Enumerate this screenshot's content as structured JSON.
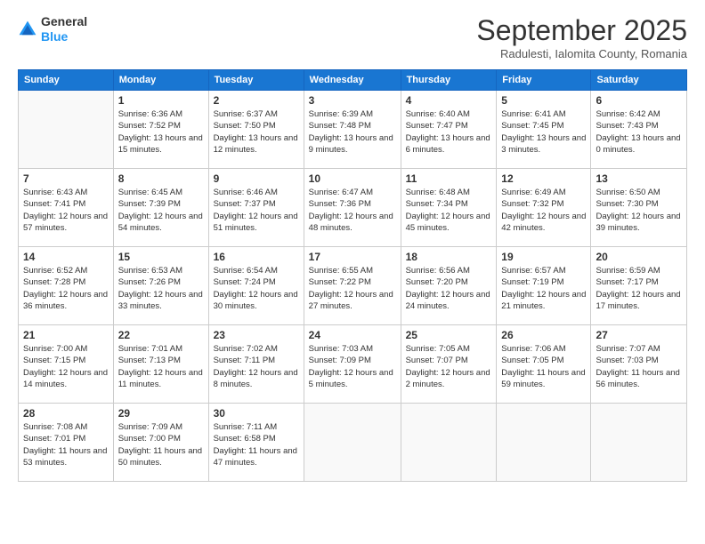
{
  "header": {
    "logo_general": "General",
    "logo_blue": "Blue",
    "month_title": "September 2025",
    "subtitle": "Radulesti, Ialomita County, Romania"
  },
  "days_of_week": [
    "Sunday",
    "Monday",
    "Tuesday",
    "Wednesday",
    "Thursday",
    "Friday",
    "Saturday"
  ],
  "weeks": [
    [
      {
        "day": "",
        "empty": true
      },
      {
        "day": "1",
        "sunrise": "Sunrise: 6:36 AM",
        "sunset": "Sunset: 7:52 PM",
        "daylight": "Daylight: 13 hours and 15 minutes."
      },
      {
        "day": "2",
        "sunrise": "Sunrise: 6:37 AM",
        "sunset": "Sunset: 7:50 PM",
        "daylight": "Daylight: 13 hours and 12 minutes."
      },
      {
        "day": "3",
        "sunrise": "Sunrise: 6:39 AM",
        "sunset": "Sunset: 7:48 PM",
        "daylight": "Daylight: 13 hours and 9 minutes."
      },
      {
        "day": "4",
        "sunrise": "Sunrise: 6:40 AM",
        "sunset": "Sunset: 7:47 PM",
        "daylight": "Daylight: 13 hours and 6 minutes."
      },
      {
        "day": "5",
        "sunrise": "Sunrise: 6:41 AM",
        "sunset": "Sunset: 7:45 PM",
        "daylight": "Daylight: 13 hours and 3 minutes."
      },
      {
        "day": "6",
        "sunrise": "Sunrise: 6:42 AM",
        "sunset": "Sunset: 7:43 PM",
        "daylight": "Daylight: 13 hours and 0 minutes."
      }
    ],
    [
      {
        "day": "7",
        "sunrise": "Sunrise: 6:43 AM",
        "sunset": "Sunset: 7:41 PM",
        "daylight": "Daylight: 12 hours and 57 minutes."
      },
      {
        "day": "8",
        "sunrise": "Sunrise: 6:45 AM",
        "sunset": "Sunset: 7:39 PM",
        "daylight": "Daylight: 12 hours and 54 minutes."
      },
      {
        "day": "9",
        "sunrise": "Sunrise: 6:46 AM",
        "sunset": "Sunset: 7:37 PM",
        "daylight": "Daylight: 12 hours and 51 minutes."
      },
      {
        "day": "10",
        "sunrise": "Sunrise: 6:47 AM",
        "sunset": "Sunset: 7:36 PM",
        "daylight": "Daylight: 12 hours and 48 minutes."
      },
      {
        "day": "11",
        "sunrise": "Sunrise: 6:48 AM",
        "sunset": "Sunset: 7:34 PM",
        "daylight": "Daylight: 12 hours and 45 minutes."
      },
      {
        "day": "12",
        "sunrise": "Sunrise: 6:49 AM",
        "sunset": "Sunset: 7:32 PM",
        "daylight": "Daylight: 12 hours and 42 minutes."
      },
      {
        "day": "13",
        "sunrise": "Sunrise: 6:50 AM",
        "sunset": "Sunset: 7:30 PM",
        "daylight": "Daylight: 12 hours and 39 minutes."
      }
    ],
    [
      {
        "day": "14",
        "sunrise": "Sunrise: 6:52 AM",
        "sunset": "Sunset: 7:28 PM",
        "daylight": "Daylight: 12 hours and 36 minutes."
      },
      {
        "day": "15",
        "sunrise": "Sunrise: 6:53 AM",
        "sunset": "Sunset: 7:26 PM",
        "daylight": "Daylight: 12 hours and 33 minutes."
      },
      {
        "day": "16",
        "sunrise": "Sunrise: 6:54 AM",
        "sunset": "Sunset: 7:24 PM",
        "daylight": "Daylight: 12 hours and 30 minutes."
      },
      {
        "day": "17",
        "sunrise": "Sunrise: 6:55 AM",
        "sunset": "Sunset: 7:22 PM",
        "daylight": "Daylight: 12 hours and 27 minutes."
      },
      {
        "day": "18",
        "sunrise": "Sunrise: 6:56 AM",
        "sunset": "Sunset: 7:20 PM",
        "daylight": "Daylight: 12 hours and 24 minutes."
      },
      {
        "day": "19",
        "sunrise": "Sunrise: 6:57 AM",
        "sunset": "Sunset: 7:19 PM",
        "daylight": "Daylight: 12 hours and 21 minutes."
      },
      {
        "day": "20",
        "sunrise": "Sunrise: 6:59 AM",
        "sunset": "Sunset: 7:17 PM",
        "daylight": "Daylight: 12 hours and 17 minutes."
      }
    ],
    [
      {
        "day": "21",
        "sunrise": "Sunrise: 7:00 AM",
        "sunset": "Sunset: 7:15 PM",
        "daylight": "Daylight: 12 hours and 14 minutes."
      },
      {
        "day": "22",
        "sunrise": "Sunrise: 7:01 AM",
        "sunset": "Sunset: 7:13 PM",
        "daylight": "Daylight: 12 hours and 11 minutes."
      },
      {
        "day": "23",
        "sunrise": "Sunrise: 7:02 AM",
        "sunset": "Sunset: 7:11 PM",
        "daylight": "Daylight: 12 hours and 8 minutes."
      },
      {
        "day": "24",
        "sunrise": "Sunrise: 7:03 AM",
        "sunset": "Sunset: 7:09 PM",
        "daylight": "Daylight: 12 hours and 5 minutes."
      },
      {
        "day": "25",
        "sunrise": "Sunrise: 7:05 AM",
        "sunset": "Sunset: 7:07 PM",
        "daylight": "Daylight: 12 hours and 2 minutes."
      },
      {
        "day": "26",
        "sunrise": "Sunrise: 7:06 AM",
        "sunset": "Sunset: 7:05 PM",
        "daylight": "Daylight: 11 hours and 59 minutes."
      },
      {
        "day": "27",
        "sunrise": "Sunrise: 7:07 AM",
        "sunset": "Sunset: 7:03 PM",
        "daylight": "Daylight: 11 hours and 56 minutes."
      }
    ],
    [
      {
        "day": "28",
        "sunrise": "Sunrise: 7:08 AM",
        "sunset": "Sunset: 7:01 PM",
        "daylight": "Daylight: 11 hours and 53 minutes."
      },
      {
        "day": "29",
        "sunrise": "Sunrise: 7:09 AM",
        "sunset": "Sunset: 7:00 PM",
        "daylight": "Daylight: 11 hours and 50 minutes."
      },
      {
        "day": "30",
        "sunrise": "Sunrise: 7:11 AM",
        "sunset": "Sunset: 6:58 PM",
        "daylight": "Daylight: 11 hours and 47 minutes."
      },
      {
        "day": "",
        "empty": true
      },
      {
        "day": "",
        "empty": true
      },
      {
        "day": "",
        "empty": true
      },
      {
        "day": "",
        "empty": true
      }
    ]
  ]
}
